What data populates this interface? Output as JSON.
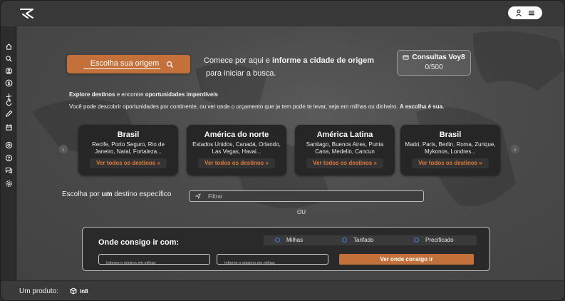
{
  "header": {
    "logo_icon": "plane-arrow-logo-icon",
    "user_icon": "user-icon",
    "menu_icon": "hamburger-menu-icon"
  },
  "sidebar": {
    "items": [
      {
        "icon": "home-icon"
      },
      {
        "icon": "search-icon"
      },
      {
        "icon": "passport-icon"
      },
      {
        "icon": "dollar-icon"
      },
      {
        "icon": "airplane-icon"
      },
      {
        "icon": "refresh-icon"
      },
      {
        "icon": "edit-icon"
      },
      {
        "icon": "calendar-icon"
      },
      {
        "icon": "target-icon"
      },
      {
        "icon": "help-icon"
      },
      {
        "icon": "chat-icon"
      },
      {
        "icon": "settings-icon"
      }
    ]
  },
  "origin": {
    "button_label": "Escolha sua origem",
    "intro_prefix": "Comece por aqui e ",
    "intro_bold": "informe a cidade de origem",
    "intro_suffix": "para iniciar a busca."
  },
  "credits": {
    "title": "Consultas Voy8",
    "value": "0/500"
  },
  "explore": {
    "title_bold_1": "Explore destinos",
    "title_mid": " e encontre ",
    "title_bold_2": "oportunidades imperdíveis",
    "description": "Você pode descobrir oportunidades por continente, ou ver onde o orçamento que ja tem pode te levar, seja em milhas ou dinheiro. ",
    "description_bold": "A escolha é sua."
  },
  "carousel": {
    "prev": "‹",
    "next": "›",
    "cards": [
      {
        "title": "Brasil",
        "description": "Recife, Porto Seguro, Rio de Janeiro, Natal, Fortaleza...",
        "button": "Ver todos os destinos »"
      },
      {
        "title": "América do norte",
        "description": "Estados Unidos, Canadá, Orlando, Las Vegas, Havai...",
        "button": "Ver todos os destinos »"
      },
      {
        "title": "América Latina",
        "description": "Santiago, Buenos Aires, Punta Cana, Medelin, Cancun",
        "button": "Ver todos os destinos »"
      },
      {
        "title": "Brasil",
        "description": "Madri, Paris, Berlin, Roma, Zurique, Mykonos, Londres...",
        "button": "Ver todos os destinos »"
      }
    ]
  },
  "specific": {
    "label_prefix": "Escolha por ",
    "label_bold": "um",
    "label_suffix": " destino específico",
    "filter_placeholder": "Filtrar",
    "or_label": "OU"
  },
  "budget": {
    "title": "Onde consigo ir com:",
    "options": [
      "Milhas",
      "Tarifado",
      "Precificado"
    ],
    "min_placeholder": "Informe o mínimo em milhas",
    "max_placeholder": "Informe o máximo em milhas",
    "submit_label": "Ver onde consigo ir"
  },
  "footer": {
    "label": "Um produto:",
    "brand": "in8"
  },
  "colors": {
    "accent": "#c4703a",
    "radio": "#4a7fd4"
  }
}
